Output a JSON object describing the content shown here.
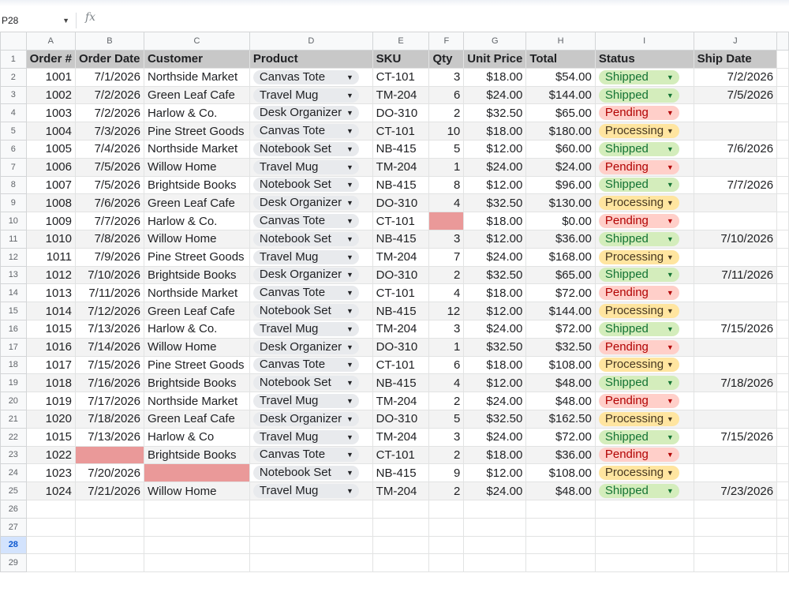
{
  "formula_bar": {
    "name_box": "P28",
    "fx_label": "fx",
    "name_dropdown_icon": "caret-down-icon"
  },
  "columns": [
    "A",
    "B",
    "C",
    "D",
    "E",
    "F",
    "G",
    "H",
    "I",
    "J"
  ],
  "header": [
    "Order #",
    "Order Date",
    "Customer",
    "Product",
    "SKU",
    "Qty",
    "Unit Price",
    "Total",
    "Status",
    "Ship Date"
  ],
  "rows": [
    [
      "1001",
      "7/1/2026",
      "Northside Market",
      "Canvas Tote",
      "CT-101",
      "3",
      "$18.00",
      "$54.00",
      "Shipped",
      "7/2/2026"
    ],
    [
      "1002",
      "7/2/2026",
      "Green Leaf Cafe",
      "Travel Mug",
      "TM-204",
      "6",
      "$24.00",
      "$144.00",
      "Shipped",
      "7/5/2026"
    ],
    [
      "1003",
      "7/2/2026",
      "Harlow & Co.",
      "Desk Organizer",
      "DO-310",
      "2",
      "$32.50",
      "$65.00",
      "Pending",
      ""
    ],
    [
      "1004",
      "7/3/2026",
      "Pine Street Goods",
      "Canvas Tote",
      "CT-101",
      "10",
      "$18.00",
      "$180.00",
      "Processing",
      ""
    ],
    [
      "1005",
      "7/4/2026",
      "Northside Market",
      "Notebook Set",
      "NB-415",
      "5",
      "$12.00",
      "$60.00",
      "Shipped",
      "7/6/2026"
    ],
    [
      "1006",
      "7/5/2026",
      "Willow Home",
      "Travel Mug",
      "TM-204",
      "1",
      "$24.00",
      "$24.00",
      "Pending",
      ""
    ],
    [
      "1007",
      "7/5/2026",
      "Brightside Books",
      "Notebook Set",
      "NB-415",
      "8",
      "$12.00",
      "$96.00",
      "Shipped",
      "7/7/2026"
    ],
    [
      "1008",
      "7/6/2026",
      "Green Leaf Cafe",
      "Desk Organizer",
      "DO-310",
      "4",
      "$32.50",
      "$130.00",
      "Processing",
      ""
    ],
    [
      "1009",
      "7/7/2026",
      "Harlow & Co.",
      "Canvas Tote",
      "CT-101",
      "",
      "$18.00",
      "$0.00",
      "Pending",
      ""
    ],
    [
      "1010",
      "7/8/2026",
      "Willow Home",
      "Notebook Set",
      "NB-415",
      "3",
      "$12.00",
      "$36.00",
      "Shipped",
      "7/10/2026"
    ],
    [
      "1011",
      "7/9/2026",
      "Pine Street Goods",
      "Travel Mug",
      "TM-204",
      "7",
      "$24.00",
      "$168.00",
      "Processing",
      ""
    ],
    [
      "1012",
      "7/10/2026",
      "Brightside Books",
      "Desk Organizer",
      "DO-310",
      "2",
      "$32.50",
      "$65.00",
      "Shipped",
      "7/11/2026"
    ],
    [
      "1013",
      "7/11/2026",
      "Northside Market",
      "Canvas Tote",
      "CT-101",
      "4",
      "$18.00",
      "$72.00",
      "Pending",
      ""
    ],
    [
      "1014",
      "7/12/2026",
      "Green Leaf Cafe",
      "Notebook Set",
      "NB-415",
      "12",
      "$12.00",
      "$144.00",
      "Processing",
      ""
    ],
    [
      "1015",
      "7/13/2026",
      "Harlow & Co.",
      "Travel Mug",
      "TM-204",
      "3",
      "$24.00",
      "$72.00",
      "Shipped",
      "7/15/2026"
    ],
    [
      "1016",
      "7/14/2026",
      "Willow Home",
      "Desk Organizer",
      "DO-310",
      "1",
      "$32.50",
      "$32.50",
      "Pending",
      ""
    ],
    [
      "1017",
      "7/15/2026",
      "Pine Street Goods",
      "Canvas Tote",
      "CT-101",
      "6",
      "$18.00",
      "$108.00",
      "Processing",
      ""
    ],
    [
      "1018",
      "7/16/2026",
      "Brightside Books",
      "Notebook Set",
      "NB-415",
      "4",
      "$12.00",
      "$48.00",
      "Shipped",
      "7/18/2026"
    ],
    [
      "1019",
      "7/17/2026",
      "Northside Market",
      "Travel Mug",
      "TM-204",
      "2",
      "$24.00",
      "$48.00",
      "Pending",
      ""
    ],
    [
      "1020",
      "7/18/2026",
      "Green Leaf Cafe",
      "Desk Organizer",
      "DO-310",
      "5",
      "$32.50",
      "$162.50",
      "Processing",
      ""
    ],
    [
      "1015",
      "7/13/2026",
      "Harlow & Co",
      "Travel Mug",
      "TM-204",
      "3",
      "$24.00",
      "$72.00",
      "Shipped",
      "7/15/2026"
    ],
    [
      "1022",
      "",
      "Brightside Books",
      "Canvas Tote",
      "CT-101",
      "2",
      "$18.00",
      "$36.00",
      "Pending",
      ""
    ],
    [
      "1023",
      "7/20/2026",
      "",
      "Notebook Set",
      "NB-415",
      "9",
      "$12.00",
      "$108.00",
      "Processing",
      ""
    ],
    [
      "1024",
      "7/21/2026",
      "Willow Home",
      "Travel Mug",
      "TM-204",
      "2",
      "$24.00",
      "$48.00",
      "Shipped",
      "7/23/2026"
    ]
  ],
  "flagged_cells": [
    "F10",
    "B23",
    "C24"
  ],
  "empty_rows": [
    "26",
    "27",
    "28",
    "29"
  ],
  "selected_row": "28",
  "colors": {
    "header_fill": "#c8c8c8",
    "stripe_fill": "#f3f3f3",
    "flag_fill": "#ea9999",
    "shipped_chip": "#d4edbc",
    "pending_chip": "#ffcfc9",
    "processing_chip": "#ffe5a0",
    "product_chip": "#e8eaed"
  },
  "icons": {
    "chip_dropdown": "caret-down-icon"
  }
}
